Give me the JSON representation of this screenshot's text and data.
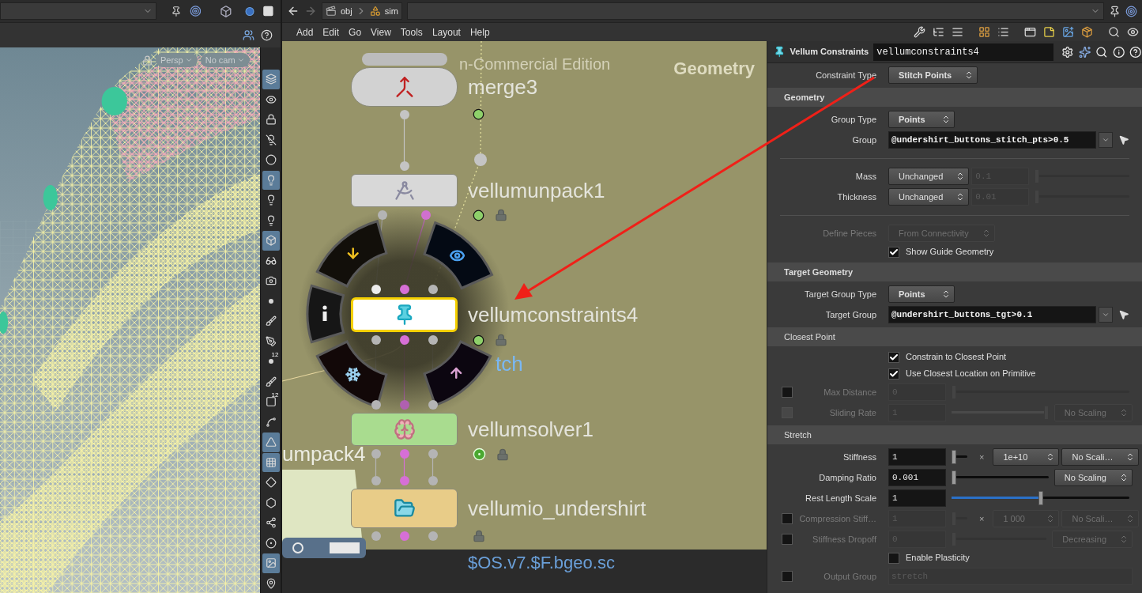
{
  "viewport": {
    "camera_menus": [
      {
        "label": "Persp"
      },
      {
        "label": "No cam"
      }
    ],
    "tools": [
      {
        "selected": true
      },
      {
        "selected": false
      },
      {
        "selected": false
      },
      {
        "selected": false
      },
      {
        "selected": false
      },
      {
        "selected": true
      },
      {
        "selected": false
      },
      {
        "selected": false
      },
      {
        "selected": true
      },
      {
        "selected": false
      },
      {
        "selected": false
      },
      {
        "selected": false
      },
      {
        "selected": false
      },
      {
        "selected": false
      },
      {
        "selected": false,
        "badge": "12"
      },
      {
        "selected": false
      },
      {
        "selected": false,
        "badge": "12"
      },
      {
        "selected": false
      },
      {
        "selected": true
      },
      {
        "selected": true
      },
      {
        "selected": false
      },
      {
        "selected": false
      },
      {
        "selected": false
      },
      {
        "selected": false
      },
      {
        "selected": true
      },
      {
        "selected": false
      }
    ]
  },
  "network": {
    "path": [
      "obj",
      "sim"
    ],
    "menu": [
      "Add",
      "Edit",
      "Go",
      "View",
      "Tools",
      "Layout",
      "Help"
    ],
    "watermark": "n-Commercial Edition",
    "context": "Geometry",
    "nodes": [
      {
        "name": "merge3",
        "kind": "merge",
        "color": "#d2d2d2",
        "selected": false,
        "outputs": [
          {
            "color": "#c4c4c4"
          }
        ],
        "badges": [
          {
            "kind": "clock"
          }
        ]
      },
      {
        "name": "vellumunpack1",
        "kind": "unpack",
        "color": "#d8d8d8",
        "selected": false,
        "inputs": [
          {
            "color": "#c4c4c4"
          }
        ],
        "outputs": [
          {
            "color": "#b4b4b4"
          },
          {
            "color": "#d070d0"
          }
        ],
        "badges": [
          {
            "kind": "clock"
          },
          {
            "kind": "lock"
          }
        ]
      },
      {
        "name": "vellumconstraints4",
        "kind": "constraints",
        "color": "#ffffff",
        "selected": true,
        "inputs": [
          {
            "color": "#ececec"
          },
          {
            "color": "#d66fd6"
          },
          {
            "color": "#b4b4b4"
          }
        ],
        "outputs": [
          {
            "color": "#b4b4b4"
          },
          {
            "color": "#d66fd6"
          },
          {
            "color": "#b4b4b4"
          }
        ],
        "badges": [
          {
            "kind": "clock"
          },
          {
            "kind": "lock"
          }
        ]
      },
      {
        "name": "vellumsolver1",
        "kind": "solver",
        "color": "#a9dc8f",
        "selected": false,
        "inputs": [
          {
            "color": "#b4b4b4"
          },
          {
            "color": "#b060b0"
          },
          {
            "color": "#b4b4b4"
          }
        ],
        "outputs": [
          {
            "color": "#b4b4b4"
          },
          {
            "color": "#d66fd6"
          },
          {
            "color": "#b4b4b4"
          }
        ],
        "badges": [
          {
            "kind": "display"
          },
          {
            "kind": "lock"
          }
        ]
      },
      {
        "name": "vellumio_undershirt",
        "kind": "file",
        "color": "#e8cc88",
        "selected": false,
        "inputs": [
          {
            "color": "#b4b4b4"
          },
          {
            "color": "#d66fd6"
          },
          {
            "color": "#b4b4b4"
          }
        ],
        "outputs": [
          {
            "color": "#b4b4b4"
          },
          {
            "color": "#d66fd6"
          },
          {
            "color": "#b4b4b4"
          }
        ],
        "badges": [
          {
            "kind": "lock"
          }
        ],
        "comment": "$OS.v7.$F.bgeo.sc"
      }
    ],
    "partial_labels": [
      "umpack4",
      "tch"
    ]
  },
  "parameters": {
    "node_type": "Vellum Constraints",
    "node_name": "vellumconstraints4",
    "rows": [
      {
        "kind": "param",
        "label": "Constraint Type",
        "widgets": [
          {
            "kind": "menu",
            "value": "Stitch Points",
            "modified": true,
            "disabled": false
          }
        ]
      },
      {
        "kind": "section",
        "title": "Geometry",
        "modified": true
      },
      {
        "kind": "param",
        "label": "Group Type",
        "widgets": [
          {
            "kind": "menu",
            "value": "Points",
            "modified": true,
            "disabled": false
          }
        ]
      },
      {
        "kind": "param",
        "label": "Group",
        "widgets": [
          {
            "kind": "string",
            "value": "@undershirt_buttons_stitch_pts>0.5",
            "modified": true,
            "disabled": false,
            "menu_button": true,
            "picker": true
          }
        ]
      },
      {
        "kind": "separator"
      },
      {
        "kind": "param",
        "label": "Mass",
        "widgets": [
          {
            "kind": "menu",
            "value": "Unchanged",
            "modified": false,
            "disabled": false
          },
          {
            "kind": "number",
            "value": "0.1",
            "disabled": true
          },
          {
            "kind": "slider",
            "level": 0,
            "disabled": true
          }
        ]
      },
      {
        "kind": "param",
        "label": "Thickness",
        "widgets": [
          {
            "kind": "menu",
            "value": "Unchanged",
            "modified": false,
            "disabled": false
          },
          {
            "kind": "number",
            "value": "0.01",
            "disabled": true
          },
          {
            "kind": "slider",
            "level": 0,
            "disabled": true
          }
        ]
      },
      {
        "kind": "separator"
      },
      {
        "kind": "param",
        "label": "Define Pieces",
        "disabled": true,
        "widgets": [
          {
            "kind": "menu",
            "value": "From Connectivity",
            "modified": false,
            "disabled": true
          }
        ]
      },
      {
        "kind": "param",
        "widgets": [
          {
            "kind": "toggle",
            "label": "Show Guide Geometry",
            "checked": true
          }
        ]
      },
      {
        "kind": "section",
        "title": "Target Geometry",
        "modified": true
      },
      {
        "kind": "param",
        "label": "Target Group Type",
        "widgets": [
          {
            "kind": "menu",
            "value": "Points",
            "modified": true,
            "disabled": false
          }
        ]
      },
      {
        "kind": "param",
        "label": "Target Group",
        "widgets": [
          {
            "kind": "string",
            "value": "@undershirt_buttons_tgt>0.1",
            "modified": true,
            "disabled": false,
            "menu_button": true,
            "picker": true
          }
        ]
      },
      {
        "kind": "section",
        "title": "Closest Point",
        "modified": false
      },
      {
        "kind": "param",
        "widgets": [
          {
            "kind": "toggle",
            "label": "Constrain to Closest Point",
            "checked": true
          }
        ]
      },
      {
        "kind": "param",
        "widgets": [
          {
            "kind": "toggle",
            "label": "Use Closest Location on Primitive",
            "checked": true
          }
        ]
      },
      {
        "kind": "param",
        "label": "Max Distance",
        "disabled": true,
        "enable": {
          "checked": false,
          "disabled": false
        },
        "widgets": [
          {
            "kind": "number",
            "value": "0",
            "disabled": true
          },
          {
            "kind": "slider",
            "level": 0,
            "disabled": true
          }
        ]
      },
      {
        "kind": "param",
        "label": "Sliding Rate",
        "disabled": true,
        "enable": {
          "checked": false,
          "disabled": true
        },
        "widgets": [
          {
            "kind": "number",
            "value": "1",
            "disabled": true
          },
          {
            "kind": "slider",
            "level": 1,
            "disabled": true
          },
          {
            "kind": "menu",
            "value": "No Scaling",
            "modified": false,
            "disabled": true
          }
        ]
      },
      {
        "kind": "section",
        "title": "Stretch",
        "modified": false
      },
      {
        "kind": "param",
        "label": "Stiffness",
        "widgets": [
          {
            "kind": "number",
            "value": "1",
            "disabled": false
          },
          {
            "kind": "slider",
            "level": 0,
            "disabled": false
          },
          {
            "kind": "times",
            "text": "×"
          },
          {
            "kind": "menu",
            "value": "1e+10",
            "modified": false,
            "disabled": false
          },
          {
            "kind": "menu",
            "value": "No Scali…",
            "modified": false,
            "disabled": false
          }
        ]
      },
      {
        "kind": "param",
        "label": "Damping Ratio",
        "widgets": [
          {
            "kind": "number",
            "value": "0.001",
            "disabled": false
          },
          {
            "kind": "slider",
            "level": 0,
            "disabled": false
          },
          {
            "kind": "menu",
            "value": "No Scaling",
            "modified": false,
            "disabled": false
          }
        ]
      },
      {
        "kind": "param",
        "label": "Rest Length Scale",
        "widgets": [
          {
            "kind": "number",
            "value": "1",
            "disabled": false
          },
          {
            "kind": "slider",
            "level": 0.5,
            "disabled": false
          }
        ]
      },
      {
        "kind": "param",
        "label": "Compression Stiff…",
        "disabled": true,
        "enable": {
          "checked": false,
          "disabled": false
        },
        "widgets": [
          {
            "kind": "number",
            "value": "1",
            "disabled": true
          },
          {
            "kind": "slider",
            "level": 0,
            "disabled": true
          },
          {
            "kind": "times",
            "text": "×"
          },
          {
            "kind": "menu",
            "value": "1 000",
            "modified": false,
            "disabled": true
          },
          {
            "kind": "menu",
            "value": "No Scali…",
            "modified": false,
            "disabled": true
          }
        ]
      },
      {
        "kind": "param",
        "label": "Stiffness Dropoff",
        "disabled": true,
        "enable": {
          "checked": false,
          "disabled": false
        },
        "widgets": [
          {
            "kind": "number",
            "value": "0",
            "disabled": true
          },
          {
            "kind": "slider",
            "level": 0,
            "disabled": true
          },
          {
            "kind": "menu",
            "value": "Decreasing",
            "modified": false,
            "disabled": true
          }
        ]
      },
      {
        "kind": "param",
        "widgets": [
          {
            "kind": "toggle",
            "label": "Enable Plasticity",
            "checked": false
          }
        ]
      },
      {
        "kind": "param",
        "label": "Output Group",
        "disabled": true,
        "enable": {
          "checked": false,
          "disabled": false
        },
        "widgets": [
          {
            "kind": "string",
            "value": "stretch",
            "modified": false,
            "disabled": true
          }
        ]
      }
    ]
  }
}
